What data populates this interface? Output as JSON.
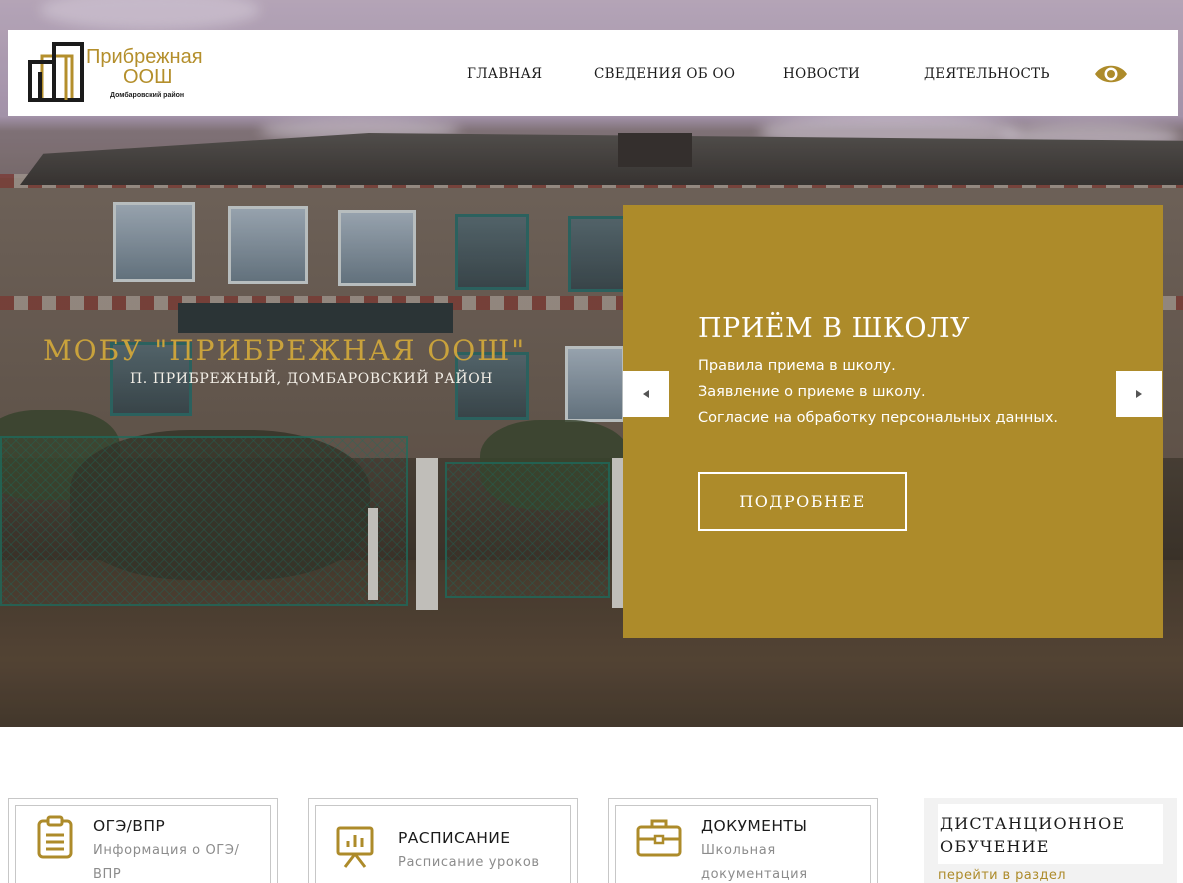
{
  "header": {
    "logo_title": "Прибрежная",
    "logo_sub": "ООШ",
    "logo_district": "Домбаровский район",
    "nav": [
      {
        "label": "ГЛАВНАЯ"
      },
      {
        "label": "СВЕДЕНИЯ ОБ ОО"
      },
      {
        "label": "НОВОСТИ"
      },
      {
        "label": "ДЕЯТЕЛЬНОСТЬ"
      }
    ],
    "accessibility_icon": "eye-icon"
  },
  "hero": {
    "title": "МОБУ \"ПРИБРЕЖНАЯ ООШ\"",
    "subtitle": "П. ПРИБРЕЖНЫЙ, ДОМБАРОВСКИЙ РАЙОН"
  },
  "slide": {
    "title": "ПРИЁМ В ШКОЛУ",
    "lines": [
      "Правила приема в школу.",
      "Заявление о приеме в школу.",
      "Согласие на обработку персональных данных."
    ],
    "button_label": "ПОДРОБНЕЕ",
    "prev_icon": "caret-left-icon",
    "next_icon": "caret-right-icon"
  },
  "cards": [
    {
      "title": "ОГЭ/ВПР",
      "desc_line1": "Информация о ОГЭ/",
      "desc_line2": "ВПР",
      "icon": "clipboard-icon"
    },
    {
      "title": "РАСПИСАНИЕ",
      "desc_line1": "Расписание уроков",
      "desc_line2": "",
      "icon": "presentation-board-icon"
    },
    {
      "title": "ДОКУМЕНТЫ",
      "desc_line1": "Школьная",
      "desc_line2": "документация",
      "icon": "briefcase-icon"
    }
  ],
  "distance": {
    "title_line1": "ДИСТАНЦИОННОЕ",
    "title_line2": "ОБУЧЕНИЕ",
    "link": "перейти в раздел"
  },
  "colors": {
    "accent": "#ad8b2a",
    "gold_text": "#c9a23c"
  }
}
